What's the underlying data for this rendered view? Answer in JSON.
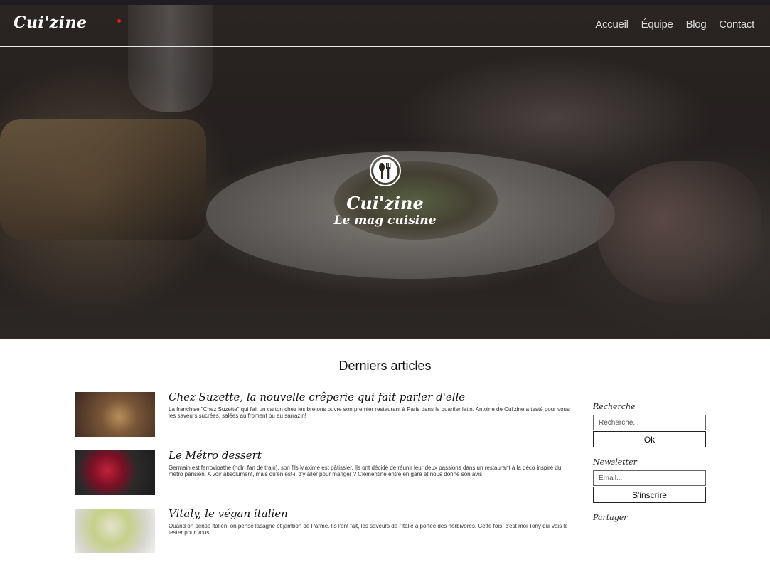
{
  "brand": {
    "logo": "Cui'zine"
  },
  "nav": {
    "items": [
      {
        "label": "Accueil"
      },
      {
        "label": "Équipe"
      },
      {
        "label": "Blog"
      },
      {
        "label": "Contact"
      }
    ]
  },
  "hero": {
    "title": "Cui'zine",
    "subtitle": "Le mag cuisine",
    "emblem_icon": "fork-spoon-icon"
  },
  "main": {
    "section_title": "Derniers articles",
    "articles": [
      {
        "title": "Chez Suzette, la nouvelle crêperie qui fait parler d'elle",
        "excerpt": "La franchise \"Chez Suzette\" qui fait un carton chez les bretons ouvre son premier restaurant à Paris dans le quartier latin. Antoine de Cui'zine a testé pour vous les saveurs sucrées, salées au froment ou au sarrazin!"
      },
      {
        "title": "Le Métro dessert",
        "excerpt": "Germain est ferrovipathe (ndlr: fan de train), son fils Maxime est pâtissier. Ils ont décidé de réunir leur deux passions dans un restaurant à la déco inspiré du métro parisien. A voir absolument, mais qu'en est-il d'y aller pour manger ? Clémentine entre en gare et nous donne son avis"
      },
      {
        "title": "Vitaly, le végan italien",
        "excerpt": "Quand on pense italien, on pense lasagne et jambon de Parme. Ils l'ont fait, les saveurs de l'Italie à portée des herbivores. Cette fois, c'est moi Tony qui vais le tester pour vous."
      }
    ]
  },
  "sidebar": {
    "search": {
      "label": "Recherche",
      "placeholder": "Recherche...",
      "button": "Ok"
    },
    "newsletter": {
      "label": "Newsletter",
      "placeholder": "Email...",
      "button": "S'inscrire"
    },
    "share": {
      "label": "Partager"
    }
  },
  "colors": {
    "accent_dot": "#e0201e",
    "hero_overlay": "#231f1e",
    "divider": "#e8e8e8"
  }
}
